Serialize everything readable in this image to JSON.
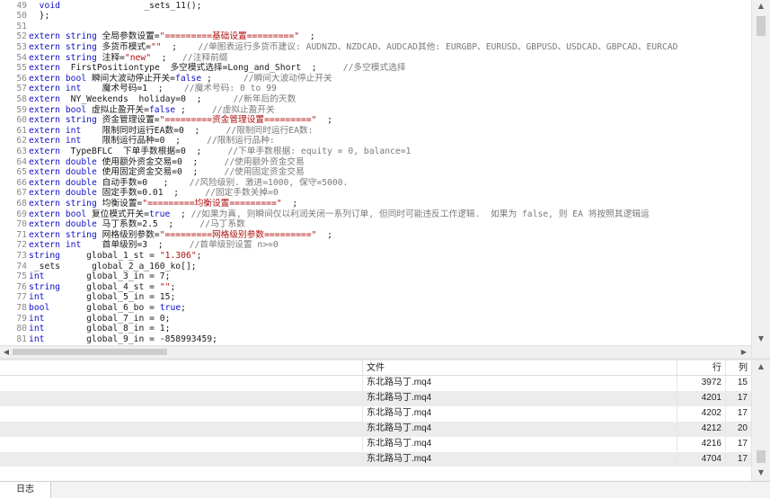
{
  "editor": {
    "lines": [
      {
        "num": "49",
        "segs": [
          {
            "t": "  ",
            "c": ""
          },
          {
            "t": "void",
            "c": "kw"
          },
          {
            "t": "                _sets_11();",
            "c": ""
          }
        ]
      },
      {
        "num": "50",
        "segs": [
          {
            "t": "  };",
            "c": ""
          }
        ]
      },
      {
        "num": "51",
        "segs": []
      },
      {
        "num": "52",
        "segs": [
          {
            "t": "extern string",
            "c": "kw"
          },
          {
            "t": " 全局参数设置=",
            "c": ""
          },
          {
            "t": "\"=========基础设置=========\"",
            "c": "str"
          },
          {
            "t": "  ;",
            "c": ""
          }
        ]
      },
      {
        "num": "53",
        "segs": [
          {
            "t": "extern string",
            "c": "kw"
          },
          {
            "t": " 多货币模式=",
            "c": ""
          },
          {
            "t": "\"\"",
            "c": "str"
          },
          {
            "t": "  ;    ",
            "c": ""
          },
          {
            "t": "//单图表运行多货币建议: AUDNZD、NZDCAD、AUDCAD其他: EURGBP、EURUSD、GBPUSD、USDCAD、GBPCAD、EURCAD",
            "c": "cm"
          }
        ]
      },
      {
        "num": "54",
        "segs": [
          {
            "t": "extern string",
            "c": "kw"
          },
          {
            "t": " 注释=",
            "c": ""
          },
          {
            "t": "\"new\"",
            "c": "str"
          },
          {
            "t": "  ;   ",
            "c": ""
          },
          {
            "t": "//注释前缀",
            "c": "cm"
          }
        ]
      },
      {
        "num": "55",
        "segs": [
          {
            "t": "extern",
            "c": "kw"
          },
          {
            "t": "  FirstPositiontype  多空模式选择=Long_and_Short  ;     ",
            "c": ""
          },
          {
            "t": "//多空模式选择",
            "c": "cm"
          }
        ]
      },
      {
        "num": "56",
        "segs": [
          {
            "t": "extern bool",
            "c": "kw"
          },
          {
            "t": " 瞬间大波动停止开关=",
            "c": ""
          },
          {
            "t": "false",
            "c": "kw"
          },
          {
            "t": " ;      ",
            "c": ""
          },
          {
            "t": "//瞬间大波动停止开关",
            "c": "cm"
          }
        ]
      },
      {
        "num": "57",
        "segs": [
          {
            "t": "extern int",
            "c": "kw"
          },
          {
            "t": "    魔术号码=1  ;    ",
            "c": ""
          },
          {
            "t": "//魔术号码: 0 to 99",
            "c": "cm"
          }
        ]
      },
      {
        "num": "58",
        "segs": [
          {
            "t": "extern",
            "c": "kw"
          },
          {
            "t": "  NY_Weekends  holiday=0  ;      ",
            "c": ""
          },
          {
            "t": "//新年后的天数",
            "c": "cm"
          }
        ]
      },
      {
        "num": "59",
        "segs": [
          {
            "t": "extern bool",
            "c": "kw"
          },
          {
            "t": " 虚拟止盈开关=",
            "c": ""
          },
          {
            "t": "false",
            "c": "kw"
          },
          {
            "t": " ;     ",
            "c": ""
          },
          {
            "t": "//虚拟止盈开关",
            "c": "cm"
          }
        ]
      },
      {
        "num": "60",
        "segs": [
          {
            "t": "extern string",
            "c": "kw"
          },
          {
            "t": " 资金管理设置=",
            "c": ""
          },
          {
            "t": "\"=========资金管理设置=========\"",
            "c": "str"
          },
          {
            "t": "  ;",
            "c": ""
          }
        ]
      },
      {
        "num": "61",
        "segs": [
          {
            "t": "extern int",
            "c": "kw"
          },
          {
            "t": "    限制同时运行EA数=0  ;     ",
            "c": ""
          },
          {
            "t": "//限制同时运行EA数:",
            "c": "cm"
          }
        ]
      },
      {
        "num": "62",
        "segs": [
          {
            "t": "extern int",
            "c": "kw"
          },
          {
            "t": "    限制运行品种=0  ;     ",
            "c": ""
          },
          {
            "t": "//限制运行品种:",
            "c": "cm"
          }
        ]
      },
      {
        "num": "63",
        "segs": [
          {
            "t": "extern",
            "c": "kw"
          },
          {
            "t": "  TypeBFLC  下单手数根据=0  ;     ",
            "c": ""
          },
          {
            "t": "//下单手数根据: equity = 0, balance=1",
            "c": "cm"
          }
        ]
      },
      {
        "num": "64",
        "segs": [
          {
            "t": "extern double",
            "c": "kw"
          },
          {
            "t": " 使用额外资金交易=0  ;     ",
            "c": ""
          },
          {
            "t": "//使用额外资金交易",
            "c": "cm"
          }
        ]
      },
      {
        "num": "65",
        "segs": [
          {
            "t": "extern double",
            "c": "kw"
          },
          {
            "t": " 使用固定资金交易=0  ;     ",
            "c": ""
          },
          {
            "t": "//使用固定资金交易",
            "c": "cm"
          }
        ]
      },
      {
        "num": "66",
        "segs": [
          {
            "t": "extern double",
            "c": "kw"
          },
          {
            "t": " 自动手数=0   ;    ",
            "c": ""
          },
          {
            "t": "//风险级别. 激进=1000, 保守=5000.",
            "c": "cm"
          }
        ]
      },
      {
        "num": "67",
        "segs": [
          {
            "t": "extern double",
            "c": "kw"
          },
          {
            "t": " 固定手数=0.01  ;     ",
            "c": ""
          },
          {
            "t": "//固定手数关掉=0",
            "c": "cm"
          }
        ]
      },
      {
        "num": "68",
        "segs": [
          {
            "t": "extern string",
            "c": "kw"
          },
          {
            "t": " 均衡设置=",
            "c": ""
          },
          {
            "t": "\"=========均衡设置=========\"",
            "c": "str"
          },
          {
            "t": "  ;",
            "c": ""
          }
        ]
      },
      {
        "num": "69",
        "segs": [
          {
            "t": "extern bool",
            "c": "kw"
          },
          {
            "t": " 复位模式开关=",
            "c": ""
          },
          {
            "t": "true",
            "c": "kw"
          },
          {
            "t": "  ; ",
            "c": ""
          },
          {
            "t": "//如果为真, 则瞬间仅以利润关闭一系列订单, 但同时可能违反工作逻辑.  如果为 false, 则 EA 将按照其逻辑运",
            "c": "cm"
          }
        ]
      },
      {
        "num": "70",
        "segs": [
          {
            "t": "extern double",
            "c": "kw"
          },
          {
            "t": " 马丁系数=2.5  ;     ",
            "c": ""
          },
          {
            "t": "//马丁系数",
            "c": "cm"
          }
        ]
      },
      {
        "num": "71",
        "segs": [
          {
            "t": "extern string",
            "c": "kw"
          },
          {
            "t": " 网格级别参数=",
            "c": ""
          },
          {
            "t": "\"=========网格级别参数=========\"",
            "c": "str"
          },
          {
            "t": "  ;",
            "c": ""
          }
        ]
      },
      {
        "num": "72",
        "segs": [
          {
            "t": "extern int",
            "c": "kw"
          },
          {
            "t": "    首单级别=3  ;     ",
            "c": ""
          },
          {
            "t": "//首单级别设置 n>=0",
            "c": "cm"
          }
        ]
      },
      {
        "num": "73",
        "segs": [
          {
            "t": "string",
            "c": "kw"
          },
          {
            "t": "     global_1_st = ",
            "c": ""
          },
          {
            "t": "\"1.306\"",
            "c": "str"
          },
          {
            "t": ";",
            "c": ""
          }
        ]
      },
      {
        "num": "74",
        "segs": [
          {
            "t": " _sets      global_2_a_160_ko[];",
            "c": ""
          }
        ]
      },
      {
        "num": "75",
        "segs": [
          {
            "t": "int",
            "c": "kw"
          },
          {
            "t": "        global_3_in = 7;",
            "c": ""
          }
        ]
      },
      {
        "num": "76",
        "segs": [
          {
            "t": "string",
            "c": "kw"
          },
          {
            "t": "     global_4_st = ",
            "c": ""
          },
          {
            "t": "\"\"",
            "c": "str"
          },
          {
            "t": ";",
            "c": ""
          }
        ]
      },
      {
        "num": "77",
        "segs": [
          {
            "t": "int",
            "c": "kw"
          },
          {
            "t": "        global_5_in = 15;",
            "c": ""
          }
        ]
      },
      {
        "num": "78",
        "segs": [
          {
            "t": "bool",
            "c": "kw"
          },
          {
            "t": "       global_6_bo = ",
            "c": ""
          },
          {
            "t": "true",
            "c": "kw"
          },
          {
            "t": ";",
            "c": ""
          }
        ]
      },
      {
        "num": "79",
        "segs": [
          {
            "t": "int",
            "c": "kw"
          },
          {
            "t": "        global_7_in = 0;",
            "c": ""
          }
        ]
      },
      {
        "num": "80",
        "segs": [
          {
            "t": "int",
            "c": "kw"
          },
          {
            "t": "        global_8_in = 1;",
            "c": ""
          }
        ]
      },
      {
        "num": "81",
        "segs": [
          {
            "t": "int",
            "c": "kw"
          },
          {
            "t": "        global_9_in = -858993459;",
            "c": ""
          }
        ]
      }
    ]
  },
  "icons": {
    "up": "▲",
    "down": "▼",
    "left": "◀",
    "right": "▶"
  },
  "results": {
    "headers": {
      "file": "文件",
      "line": "行",
      "col": "列"
    },
    "rows": [
      {
        "file": "东北路马丁.mq4",
        "line": "3972",
        "col": "15"
      },
      {
        "file": "东北路马丁.mq4",
        "line": "4201",
        "col": "17"
      },
      {
        "file": "东北路马丁.mq4",
        "line": "4202",
        "col": "17"
      },
      {
        "file": "东北路马丁.mq4",
        "line": "4212",
        "col": "20"
      },
      {
        "file": "东北路马丁.mq4",
        "line": "4216",
        "col": "17"
      },
      {
        "file": "东北路马丁.mq4",
        "line": "4704",
        "col": "17"
      }
    ]
  },
  "tabs": {
    "log": "日志"
  },
  "colors": {
    "keyword": "#1010c8",
    "string": "#b01010",
    "comment": "#7a7a7a",
    "alt_row": "#ececec"
  }
}
